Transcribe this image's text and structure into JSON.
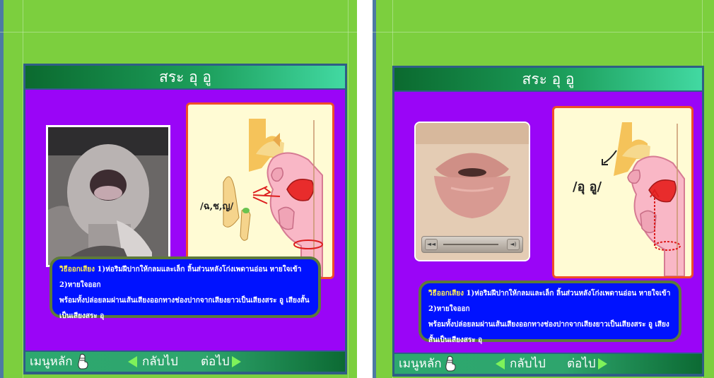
{
  "colors": {
    "background": "#7ccf3e",
    "panel_frame": "#2f5d86",
    "content": "#9a05f7",
    "description_box": "#0012ff",
    "diagram_border": "#ef4f28",
    "diagram_fill": "#fffbd4",
    "arrow": "#7ef25a"
  },
  "screens": [
    {
      "title": "สระ อุ อู",
      "diagram_label": "/ฉ,ช,ญ/",
      "photo_icon": "open-mouth-photo",
      "description": {
        "label": "วิธีออกเสียง",
        "line1": "1)ห่อริมฝีปากให้กลมและเล็ก ลิ้นส่วนหลังโก่งเพดานอ่อน หายใจเข้า 2)หายใจออก",
        "line2": "พร้อมทั้งปล่อยลมผ่านเส้นเสียงออกทางช่องปากจากเสียงยาวเป็นเสียงสระ อู เสียงสั้นเป็นเสียงสระ อุ"
      },
      "nav": {
        "menu": "เมนูหลัก",
        "back": "กลับไป",
        "next": "ต่อไป"
      }
    },
    {
      "title": "สระ อุ อู",
      "diagram_label": "/อุ อู/",
      "photo_icon": "lips-video",
      "description": {
        "label": "วิธีออกเสียง",
        "line1": "1)ห่อริมฝีปากให้กลมและเล็ก ลิ้นส่วนหลังโก่งเพดานอ่อน หายใจเข้า 2)หายใจออก",
        "line2": "พร้อมทั้งปล่อยลมผ่านเส้นเสียงออกทางช่องปากจากเสียงยาวเป็นเสียงสระ อู เสียงสั้นเป็นเสียงสระ อุ"
      },
      "nav": {
        "menu": "เมนูหลัก",
        "back": "กลับไป",
        "next": "ต่อไป"
      }
    }
  ]
}
